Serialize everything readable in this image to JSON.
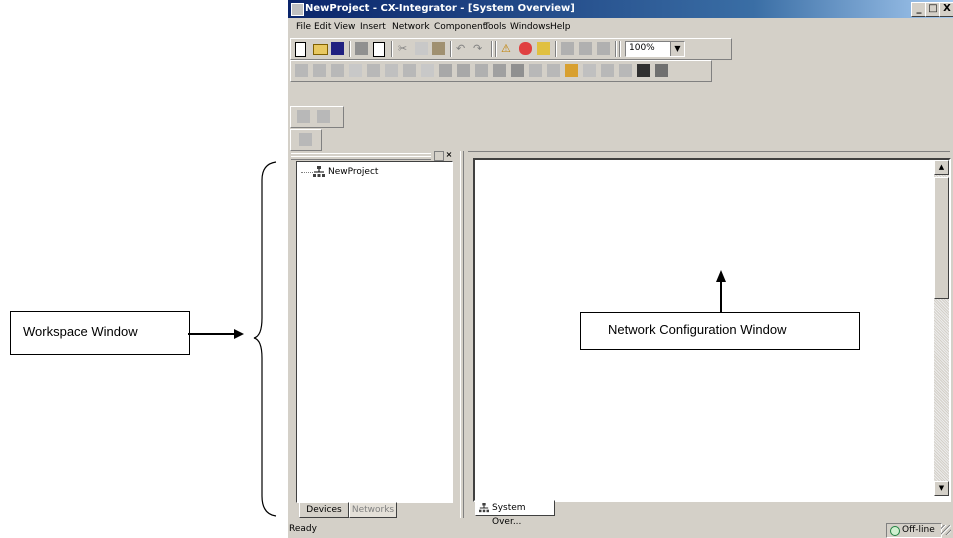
{
  "window": {
    "title": "NewProject - CX-Integrator - [System Overview]",
    "min_label": "_",
    "max_label": "□",
    "close_label": "X"
  },
  "menubar": {
    "file": "File",
    "edit": "Edit",
    "view": "View",
    "insert": "Insert",
    "network": "Network",
    "component": "Component",
    "tools": "Tools",
    "windows": "Windows",
    "help": "Help"
  },
  "toolbar": {
    "zoom_value": "100%"
  },
  "workspace": {
    "tree_root": "NewProject",
    "tabs": {
      "devices": "Devices",
      "networks": "Networks"
    }
  },
  "network_window": {
    "tab_label": "System Over..."
  },
  "statusbar": {
    "status": "Ready",
    "mode": "Off-line"
  },
  "annotations": {
    "workspace_label": "Workspace Window",
    "network_label": "Network Configuration Window"
  },
  "colors": {
    "titlebar_start": "#0a246a",
    "titlebar_end": "#a6caf0",
    "face": "#d4d0c8"
  }
}
